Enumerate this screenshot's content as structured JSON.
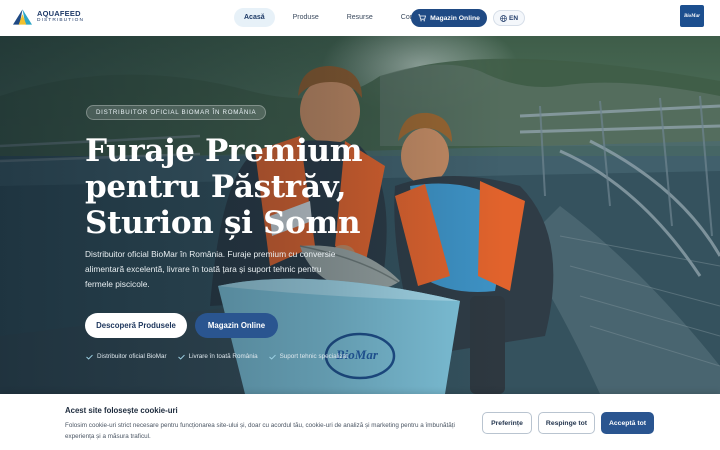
{
  "brand": {
    "name": "AQUAFEED",
    "sub": "DISTRIBUTION",
    "partner": "BioMar"
  },
  "nav": {
    "items": [
      {
        "label": "Acasă",
        "active": true
      },
      {
        "label": "Produse",
        "active": false
      },
      {
        "label": "Resurse",
        "active": false
      },
      {
        "label": "Contact",
        "active": false
      }
    ],
    "shop_label": "Magazin Online",
    "lang_label": "EN"
  },
  "hero": {
    "badge": "DISTRIBUITOR OFICIAL BIOMAR ÎN ROMÂNIA",
    "title_lines": [
      "Furaje Premium",
      "pentru Păstrăv,",
      "Sturion și Somn"
    ],
    "subtitle": "Distribuitor oficial BioMar în România. Furaje premium cu conversie alimentară excelentă, livrare în toată țara și suport tehnic pentru fermele piscicole.",
    "primary_cta": "Descoperă Produsele",
    "secondary_cta": "Magazin Online",
    "features": [
      "Distribuitor oficial BioMar",
      "Livrare în toată România",
      "Suport tehnic specializat"
    ],
    "tub_logo": "BioMar"
  },
  "cookie": {
    "title": "Acest site folosește cookie-uri",
    "text": "Folosim cookie-uri strict necesare pentru funcționarea site-ului și, doar cu acordul tău, cookie-uri de analiză și marketing pentru a îmbunătăți experiența și a măsura traficul.",
    "preferences": "Preferințe",
    "reject": "Respinge tot",
    "accept": "Acceptă tot"
  },
  "colors": {
    "primary": "#1f4a84",
    "accent": "#2a5590",
    "dark_text": "#1c2a3c",
    "nav_active_bg": "#e7f1f8"
  }
}
